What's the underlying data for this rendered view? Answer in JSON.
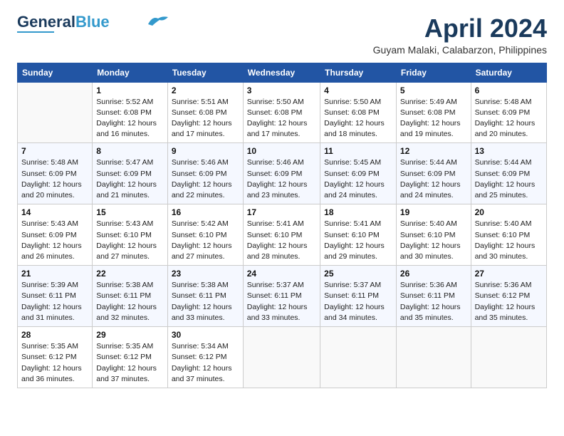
{
  "header": {
    "logo_line1": "General",
    "logo_line2": "Blue",
    "month": "April 2024",
    "location": "Guyam Malaki, Calabarzon, Philippines"
  },
  "days_of_week": [
    "Sunday",
    "Monday",
    "Tuesday",
    "Wednesday",
    "Thursday",
    "Friday",
    "Saturday"
  ],
  "weeks": [
    [
      {
        "num": "",
        "info": ""
      },
      {
        "num": "1",
        "info": "Sunrise: 5:52 AM\nSunset: 6:08 PM\nDaylight: 12 hours and 16 minutes."
      },
      {
        "num": "2",
        "info": "Sunrise: 5:51 AM\nSunset: 6:08 PM\nDaylight: 12 hours and 17 minutes."
      },
      {
        "num": "3",
        "info": "Sunrise: 5:50 AM\nSunset: 6:08 PM\nDaylight: 12 hours and 17 minutes."
      },
      {
        "num": "4",
        "info": "Sunrise: 5:50 AM\nSunset: 6:08 PM\nDaylight: 12 hours and 18 minutes."
      },
      {
        "num": "5",
        "info": "Sunrise: 5:49 AM\nSunset: 6:08 PM\nDaylight: 12 hours and 19 minutes."
      },
      {
        "num": "6",
        "info": "Sunrise: 5:48 AM\nSunset: 6:09 PM\nDaylight: 12 hours and 20 minutes."
      }
    ],
    [
      {
        "num": "7",
        "info": "Sunrise: 5:48 AM\nSunset: 6:09 PM\nDaylight: 12 hours and 20 minutes."
      },
      {
        "num": "8",
        "info": "Sunrise: 5:47 AM\nSunset: 6:09 PM\nDaylight: 12 hours and 21 minutes."
      },
      {
        "num": "9",
        "info": "Sunrise: 5:46 AM\nSunset: 6:09 PM\nDaylight: 12 hours and 22 minutes."
      },
      {
        "num": "10",
        "info": "Sunrise: 5:46 AM\nSunset: 6:09 PM\nDaylight: 12 hours and 23 minutes."
      },
      {
        "num": "11",
        "info": "Sunrise: 5:45 AM\nSunset: 6:09 PM\nDaylight: 12 hours and 24 minutes."
      },
      {
        "num": "12",
        "info": "Sunrise: 5:44 AM\nSunset: 6:09 PM\nDaylight: 12 hours and 24 minutes."
      },
      {
        "num": "13",
        "info": "Sunrise: 5:44 AM\nSunset: 6:09 PM\nDaylight: 12 hours and 25 minutes."
      }
    ],
    [
      {
        "num": "14",
        "info": "Sunrise: 5:43 AM\nSunset: 6:09 PM\nDaylight: 12 hours and 26 minutes."
      },
      {
        "num": "15",
        "info": "Sunrise: 5:43 AM\nSunset: 6:10 PM\nDaylight: 12 hours and 27 minutes."
      },
      {
        "num": "16",
        "info": "Sunrise: 5:42 AM\nSunset: 6:10 PM\nDaylight: 12 hours and 27 minutes."
      },
      {
        "num": "17",
        "info": "Sunrise: 5:41 AM\nSunset: 6:10 PM\nDaylight: 12 hours and 28 minutes."
      },
      {
        "num": "18",
        "info": "Sunrise: 5:41 AM\nSunset: 6:10 PM\nDaylight: 12 hours and 29 minutes."
      },
      {
        "num": "19",
        "info": "Sunrise: 5:40 AM\nSunset: 6:10 PM\nDaylight: 12 hours and 30 minutes."
      },
      {
        "num": "20",
        "info": "Sunrise: 5:40 AM\nSunset: 6:10 PM\nDaylight: 12 hours and 30 minutes."
      }
    ],
    [
      {
        "num": "21",
        "info": "Sunrise: 5:39 AM\nSunset: 6:11 PM\nDaylight: 12 hours and 31 minutes."
      },
      {
        "num": "22",
        "info": "Sunrise: 5:38 AM\nSunset: 6:11 PM\nDaylight: 12 hours and 32 minutes."
      },
      {
        "num": "23",
        "info": "Sunrise: 5:38 AM\nSunset: 6:11 PM\nDaylight: 12 hours and 33 minutes."
      },
      {
        "num": "24",
        "info": "Sunrise: 5:37 AM\nSunset: 6:11 PM\nDaylight: 12 hours and 33 minutes."
      },
      {
        "num": "25",
        "info": "Sunrise: 5:37 AM\nSunset: 6:11 PM\nDaylight: 12 hours and 34 minutes."
      },
      {
        "num": "26",
        "info": "Sunrise: 5:36 AM\nSunset: 6:11 PM\nDaylight: 12 hours and 35 minutes."
      },
      {
        "num": "27",
        "info": "Sunrise: 5:36 AM\nSunset: 6:12 PM\nDaylight: 12 hours and 35 minutes."
      }
    ],
    [
      {
        "num": "28",
        "info": "Sunrise: 5:35 AM\nSunset: 6:12 PM\nDaylight: 12 hours and 36 minutes."
      },
      {
        "num": "29",
        "info": "Sunrise: 5:35 AM\nSunset: 6:12 PM\nDaylight: 12 hours and 37 minutes."
      },
      {
        "num": "30",
        "info": "Sunrise: 5:34 AM\nSunset: 6:12 PM\nDaylight: 12 hours and 37 minutes."
      },
      {
        "num": "",
        "info": ""
      },
      {
        "num": "",
        "info": ""
      },
      {
        "num": "",
        "info": ""
      },
      {
        "num": "",
        "info": ""
      }
    ]
  ]
}
